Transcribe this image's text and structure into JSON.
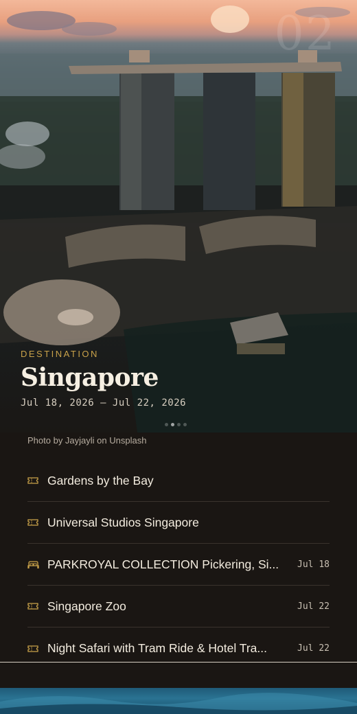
{
  "hero": {
    "page_number": "02",
    "eyebrow": "DESTINATION",
    "title": "Singapore",
    "dates": "Jul 18, 2026 – Jul 22, 2026",
    "photo_credit": "Photo by Jayjayli on Unsplash",
    "carousel": {
      "count": 4,
      "active_index": 1
    }
  },
  "items": [
    {
      "icon": "ticket-icon",
      "name": "Gardens by the Bay",
      "date": ""
    },
    {
      "icon": "ticket-icon",
      "name": "Universal Studios Singapore",
      "date": ""
    },
    {
      "icon": "bed-icon",
      "name": "PARKROYAL COLLECTION Pickering, Si...",
      "date": "Jul 18"
    },
    {
      "icon": "ticket-icon",
      "name": "Singapore Zoo",
      "date": "Jul 22"
    },
    {
      "icon": "ticket-icon",
      "name": "Night Safari with Tram Ride & Hotel Tra...",
      "date": "Jul 22"
    }
  ],
  "colors": {
    "accent": "#c9a24a",
    "background": "#1a1613"
  }
}
